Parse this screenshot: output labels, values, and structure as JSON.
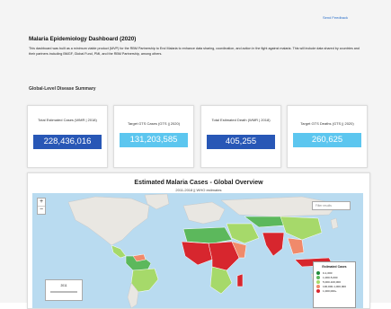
{
  "header": {
    "feedback_label": "Send Feedback"
  },
  "title": "Malaria Epidemiology Dashboard (2020)",
  "description": "This dashboard was built as a minimum viable product (MVP) for the RBM Partnership to End Malaria to enhance data sharing, coordination, and action in the fight against malaria. This will include data shared by countries and their partners including BMGF, Global Fund, PMI, and the RBM Partnership, among others.",
  "section_title": "Global-Level Disease Summary",
  "cards": [
    {
      "label": "Total Estimated Cases (WMR | 2018)",
      "value": "228,436,016",
      "color": "#2857b6"
    },
    {
      "label": "Target GTS Cases (GTS || 2020)",
      "value": "131,203,585",
      "color": "#5cc6ef"
    },
    {
      "label": "Total Estimated Death (WMR | 2018)",
      "value": "405,255",
      "color": "#2857b6"
    },
    {
      "label": "Target GTS Deaths (GTS || 2020)",
      "value": "260,625",
      "color": "#5cc6ef"
    }
  ],
  "map": {
    "title": "Estimated Malaria Cases - Global Overview",
    "subtitle": "2011-2018 || WHO estimates",
    "search_placeholder": "Filter results",
    "zoom_in": "+",
    "zoom_out": "−",
    "time_label": "2011",
    "legend": {
      "title": "Estimated Cases",
      "items": [
        {
          "label": "0-1,000",
          "color": "#1f8a3a"
        },
        {
          "label": "1,000-5,000",
          "color": "#5cb85c"
        },
        {
          "label": "5,000-100,000",
          "color": "#a6d96a"
        },
        {
          "label": "100,000-1,000,000",
          "color": "#f08a6b"
        },
        {
          "label": "1,000,000+",
          "color": "#d7262e"
        }
      ]
    }
  },
  "colors": {
    "land_unaffected": "#e9e7e2",
    "ocean": "#b9dbf0"
  }
}
